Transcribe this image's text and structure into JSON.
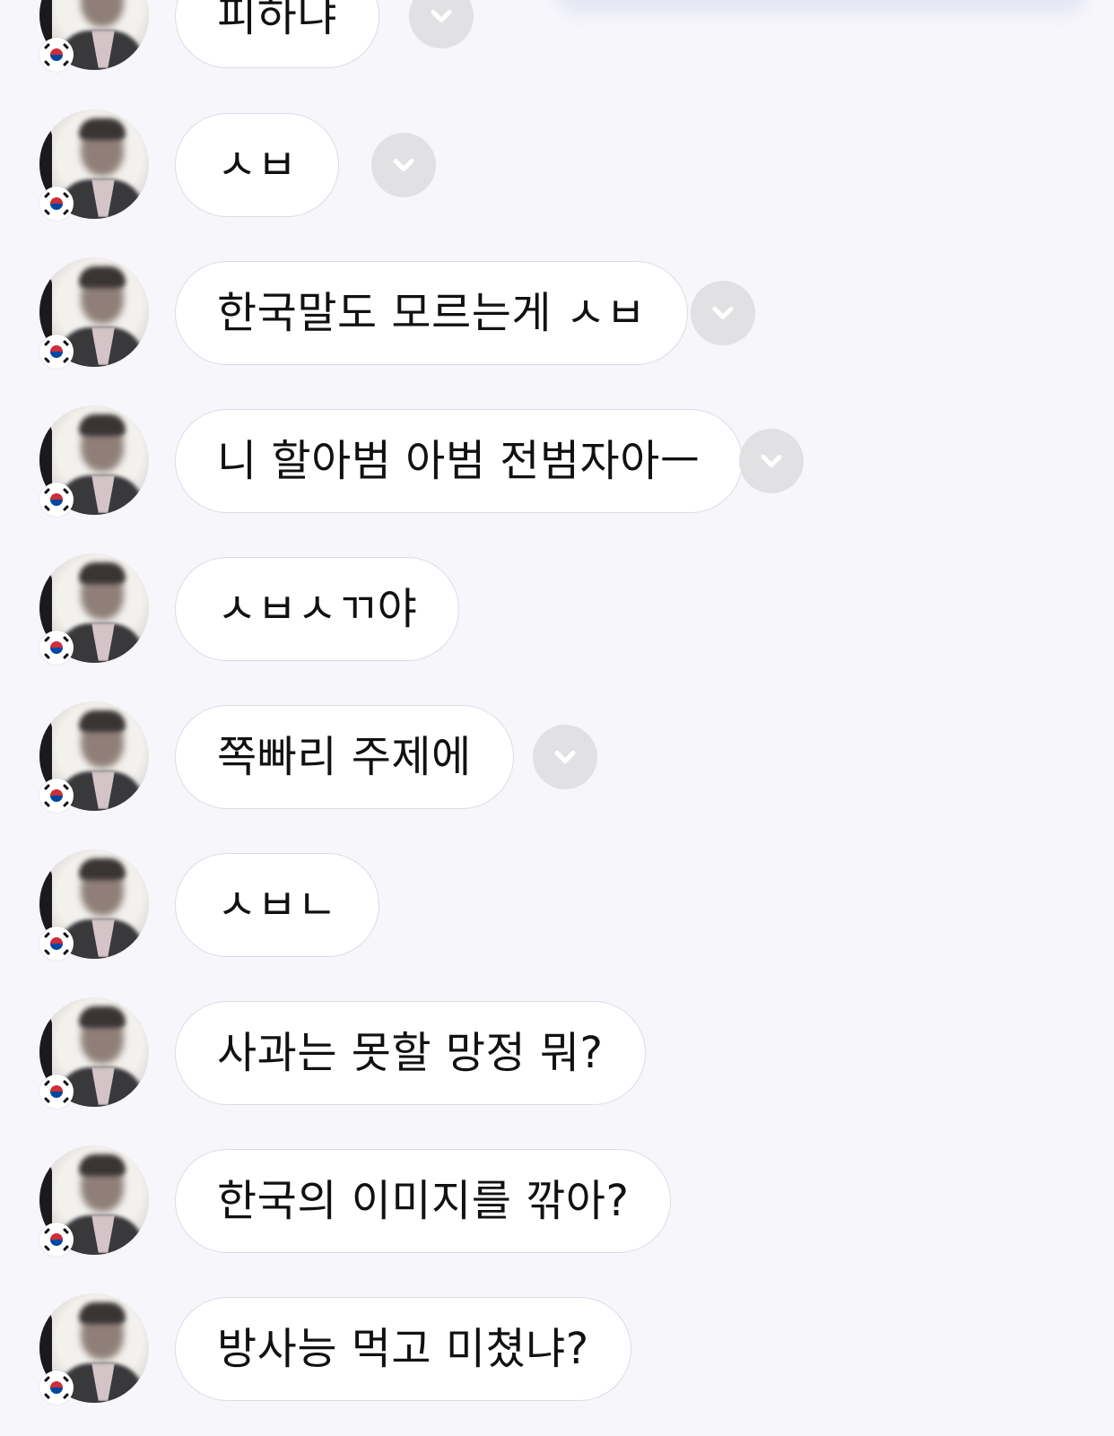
{
  "colors": {
    "background": "#f6f6fb",
    "bubble": "#ffffff",
    "bubble_border": "#dcdce4",
    "menu_button": "#e1e1e4",
    "chevron": "#ffffff"
  },
  "messages": [
    {
      "text": "피하냐",
      "has_menu": true
    },
    {
      "text": "ㅅㅂ",
      "has_menu": true
    },
    {
      "text": "한국말도 모르는게 ㅅㅂ",
      "has_menu": true
    },
    {
      "text": "니 할아범 아범 전범자아ㅡ",
      "has_menu": true
    },
    {
      "text": "ㅅㅂㅅㄲ야",
      "has_menu": false
    },
    {
      "text": "쪽빠리 주제에",
      "has_menu": true
    },
    {
      "text": "ㅅㅂㄴ",
      "has_menu": false
    },
    {
      "text": "사과는 못할 망정 뭐?",
      "has_menu": false
    },
    {
      "text": "한국의 이미지를 깎아?",
      "has_menu": false
    },
    {
      "text": "방사능 먹고 미쳤냐?",
      "has_menu": false
    }
  ],
  "icons": {
    "avatar": "user-avatar",
    "flag": "korea-flag-icon",
    "menu": "chevron-down-icon"
  }
}
